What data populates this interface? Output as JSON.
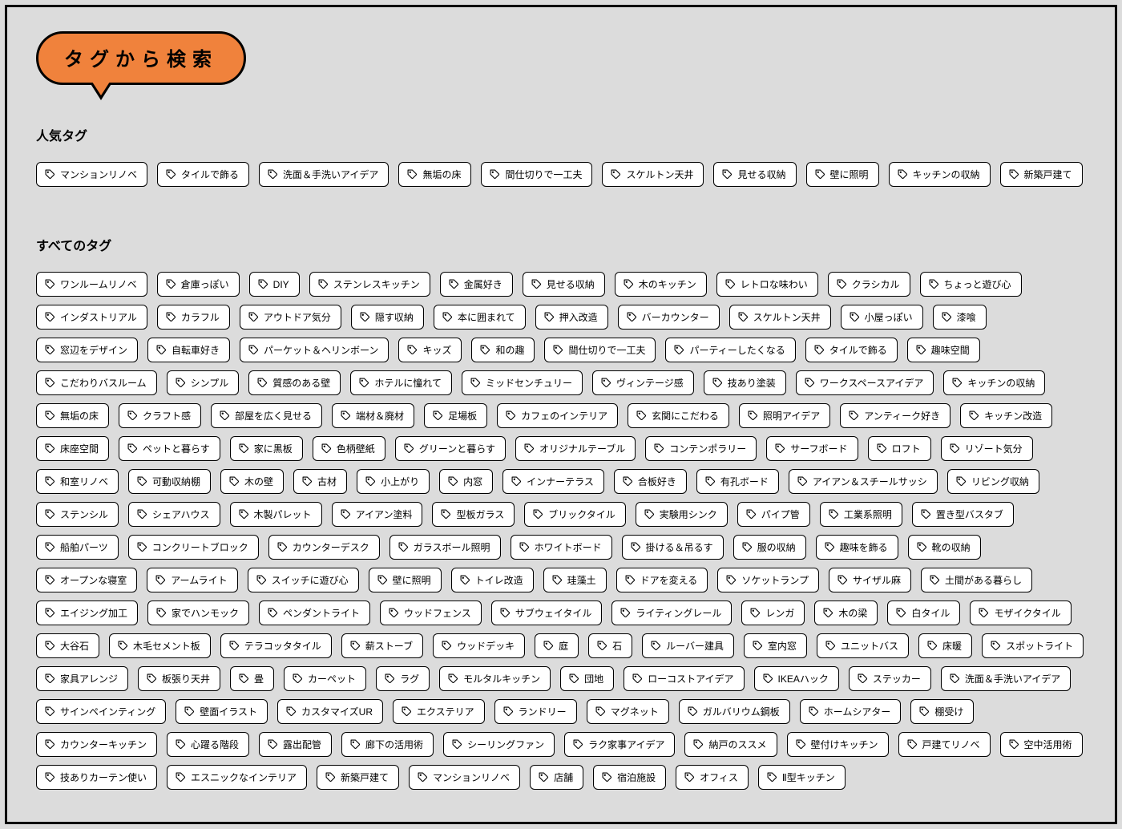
{
  "header": {
    "title": "タグから検索"
  },
  "sections": {
    "popular": {
      "heading": "人気タグ",
      "tags": [
        "マンションリノベ",
        "タイルで飾る",
        "洗面＆手洗いアイデア",
        "無垢の床",
        "間仕切りで一工夫",
        "スケルトン天井",
        "見せる収納",
        "壁に照明",
        "キッチンの収納",
        "新築戸建て"
      ]
    },
    "all": {
      "heading": "すべてのタグ",
      "tags": [
        "ワンルームリノベ",
        "倉庫っぽい",
        "DIY",
        "ステンレスキッチン",
        "金属好き",
        "見せる収納",
        "木のキッチン",
        "レトロな味わい",
        "クラシカル",
        "ちょっと遊び心",
        "インダストリアル",
        "カラフル",
        "アウトドア気分",
        "隠す収納",
        "本に囲まれて",
        "押入改造",
        "バーカウンター",
        "スケルトン天井",
        "小屋っぽい",
        "漆喰",
        "窓辺をデザイン",
        "自転車好き",
        "パーケット＆ヘリンボーン",
        "キッズ",
        "和の趣",
        "間仕切りで一工夫",
        "パーティーしたくなる",
        "タイルで飾る",
        "趣味空間",
        "こだわりバスルーム",
        "シンプル",
        "質感のある壁",
        "ホテルに憧れて",
        "ミッドセンチュリー",
        "ヴィンテージ感",
        "技あり塗装",
        "ワークスペースアイデア",
        "キッチンの収納",
        "無垢の床",
        "クラフト感",
        "部屋を広く見せる",
        "端材＆廃材",
        "足場板",
        "カフェのインテリア",
        "玄関にこだわる",
        "照明アイデア",
        "アンティーク好き",
        "キッチン改造",
        "床座空間",
        "ペットと暮らす",
        "家に黒板",
        "色柄壁紙",
        "グリーンと暮らす",
        "オリジナルテーブル",
        "コンテンポラリー",
        "サーフボード",
        "ロフト",
        "リゾート気分",
        "和室リノベ",
        "可動収納棚",
        "木の壁",
        "古材",
        "小上がり",
        "内窓",
        "インナーテラス",
        "合板好き",
        "有孔ボード",
        "アイアン＆スチールサッシ",
        "リビング収納",
        "ステンシル",
        "シェアハウス",
        "木製パレット",
        "アイアン塗料",
        "型板ガラス",
        "ブリックタイル",
        "実験用シンク",
        "パイプ管",
        "工業系照明",
        "置き型バスタブ",
        "船舶パーツ",
        "コンクリートブロック",
        "カウンターデスク",
        "ガラスボール照明",
        "ホワイトボード",
        "掛ける＆吊るす",
        "服の収納",
        "趣味を飾る",
        "靴の収納",
        "オープンな寝室",
        "アームライト",
        "スイッチに遊び心",
        "壁に照明",
        "トイレ改造",
        "珪藻土",
        "ドアを変える",
        "ソケットランプ",
        "サイザル麻",
        "土間がある暮らし",
        "エイジング加工",
        "家でハンモック",
        "ペンダントライト",
        "ウッドフェンス",
        "サブウェイタイル",
        "ライティングレール",
        "レンガ",
        "木の梁",
        "白タイル",
        "モザイクタイル",
        "大谷石",
        "木毛セメント板",
        "テラコッタタイル",
        "薪ストーブ",
        "ウッドデッキ",
        "庭",
        "石",
        "ルーバー建具",
        "室内窓",
        "ユニットバス",
        "床暖",
        "スポットライト",
        "家具アレンジ",
        "板張り天井",
        "畳",
        "カーペット",
        "ラグ",
        "モルタルキッチン",
        "団地",
        "ローコストアイデア",
        "IKEAハック",
        "ステッカー",
        "洗面＆手洗いアイデア",
        "サインペインティング",
        "壁面イラスト",
        "カスタマイズUR",
        "エクステリア",
        "ランドリー",
        "マグネット",
        "ガルバリウム鋼板",
        "ホームシアター",
        "棚受け",
        "カウンターキッチン",
        "心躍る階段",
        "露出配管",
        "廊下の活用術",
        "シーリングファン",
        "ラク家事アイデア",
        "納戸のススメ",
        "壁付けキッチン",
        "戸建てリノベ",
        "空中活用術",
        "技ありカーテン使い",
        "エスニックなインテリア",
        "新築戸建て",
        "マンションリノベ",
        "店舗",
        "宿泊施設",
        "オフィス",
        "Ⅱ型キッチン"
      ]
    }
  }
}
